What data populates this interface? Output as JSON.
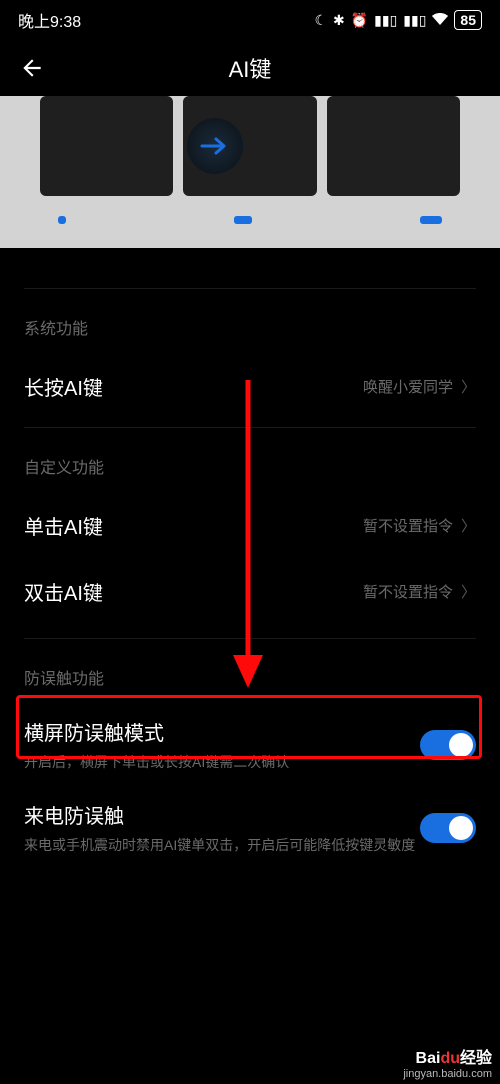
{
  "status": {
    "time": "晚上9:38",
    "battery": "85"
  },
  "header": {
    "title": "AI键"
  },
  "sections": {
    "system": {
      "header": "系统功能",
      "long_press": {
        "label": "长按AI键",
        "value": "唤醒小爱同学"
      }
    },
    "custom": {
      "header": "自定义功能",
      "single": {
        "label": "单击AI键",
        "value": "暂不设置指令"
      },
      "double": {
        "label": "双击AI键",
        "value": "暂不设置指令"
      }
    },
    "mistouch": {
      "header": "防误触功能",
      "landscape": {
        "label": "横屏防误触模式",
        "desc": "开启后，横屏下单击或长按AI键需二次确认"
      },
      "call": {
        "label": "来电防误触",
        "desc": "来电或手机震动时禁用AI键单双击，开启后可能降低按键灵敏度"
      }
    }
  },
  "watermark": {
    "brand_left": "Bai",
    "brand_red": "du",
    "brand_right": "经验",
    "url": "jingyan.baidu.com"
  }
}
